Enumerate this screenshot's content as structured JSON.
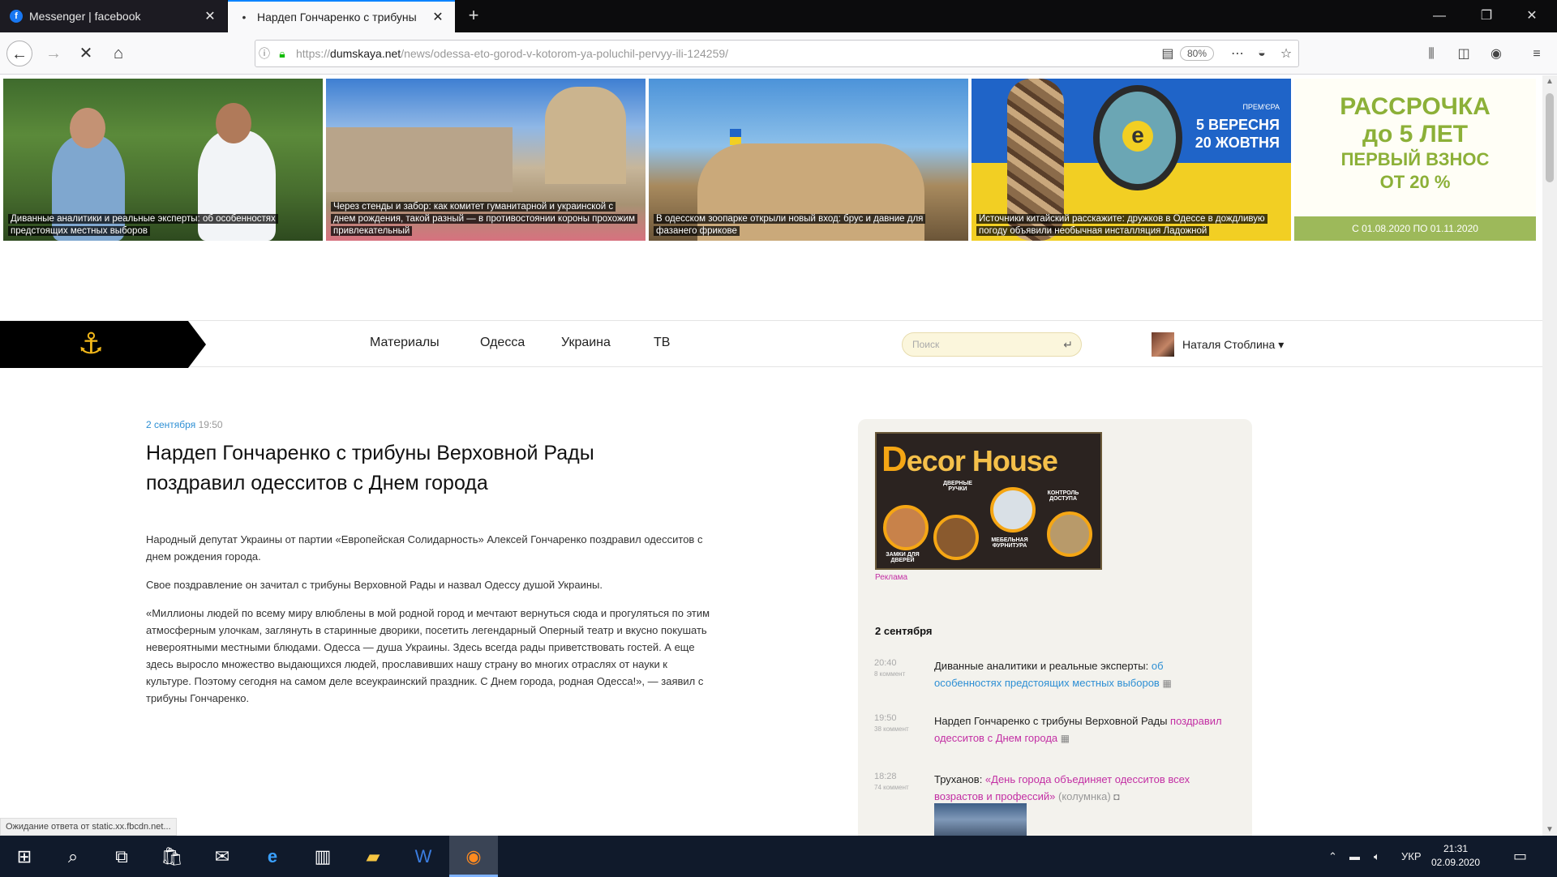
{
  "browser": {
    "tabs": [
      {
        "title": "Messenger | facebook",
        "favicon": "facebook-icon"
      },
      {
        "title": "Нардеп Гончаренко с трибуны",
        "favicon": "loading-dot-icon"
      }
    ],
    "url_prefix": "https://",
    "url_domain": "dumskaya.net",
    "url_path": "/news/odessa-eto-gorod-v-kotorom-ya-poluchil-pervyy-ili-124259/",
    "zoom": "80%",
    "status": "Ожидание ответа от static.xx.fbcdn.net..."
  },
  "news_strip": [
    {
      "caption": "Диванные аналитики и реальные эксперты: об особенностях предстоящих местных выборов"
    },
    {
      "caption": "Через стенды и забор: как комитет гуманитарной и украинской с днем рождения, такой разный — в противостоянии короны прохожим привлекательный"
    },
    {
      "caption": "В одесском зоопарке открыли новый вход: брус и давние для фазанего фрикове"
    },
    {
      "caption": "Источники китайский расскажите: дружков в Одессе в дождливую погоду объявили необычная инсталляция Ладожной"
    }
  ],
  "festival": {
    "subtitle": "ПРЕМ'ЄРА",
    "line1": "5 ВЕРЕСНЯ",
    "line2": "20 ЖОВТНЯ"
  },
  "promo": {
    "line1": "РАССРОЧКА",
    "line2": "до 5 ЛЕТ",
    "line3": "ПЕРВЫЙ ВЗНОС",
    "line4": "ОТ 20 %",
    "dates": "С 01.08.2020 ПО 01.11.2020",
    "text_color": "#8cb038"
  },
  "nav": {
    "menu": [
      "Материалы",
      "Одесса",
      "Украина",
      "ТВ"
    ],
    "search_placeholder": "Поиск",
    "user_name": "Наталя Стоблина ▾"
  },
  "article": {
    "date": "2 сентября",
    "time": "19:50",
    "title": "Нардеп Гончаренко с трибуны Верховной Рады поздравил одесситов с Днем города",
    "paragraphs": [
      "Народный депутат Украины от партии «Европейская Солидарность» Алексей Гончаренко поздравил одесситов с днем рождения города.",
      "Свое поздравление он зачитал с трибуны Верховной Рады и назвал Одессу душой Украины.",
      "«Миллионы людей по всему миру влюблены в мой родной город и мечтают вернуться сюда и прогуляться по этим атмосферным улочкам, заглянуть в старинные дворики, посетить легендарный Оперный театр и вкусно покушать невероятными местными блюдами. Одесса — душа Украины. Здесь всегда рады приветствовать гостей. А еще здесь выросло множество выдающихся людей, прославивших нашу страну во многих отраслях от науки к культуре. Поэтому сегодня на самом деле всеукраинский праздник. С Днем города, родная Одесса!», — заявил с трибуны Гончаренко."
    ]
  },
  "sidebar": {
    "ad_brand_first": "D",
    "ad_brand_rest": "ecor House",
    "ad_labels": [
      "ДВЕРНЫЕ РУЧКИ",
      "КОНТРОЛЬ ДОСТУПА",
      "ЗАМКИ ДЛЯ ДВЕРЕЙ",
      "МЕБЕЛЬНАЯ ФУРНИТУРА"
    ],
    "ad_label": "Реклама",
    "date_header": "2 сентября",
    "feed": [
      {
        "time": "20:40",
        "count": "8 коммент",
        "text": "Диванные аналитики и реальные эксперты: ",
        "link": "об особенностях предстоящих местных выборов",
        "link_color": "blue",
        "extra": "",
        "icon": "▦"
      },
      {
        "time": "19:50",
        "count": "38 коммент",
        "text": "Нардеп Гончаренко с трибуны Верховной Рады ",
        "link": "поздравил одесситов с Днем города",
        "link_color": "pink",
        "extra": "",
        "icon": "▦"
      },
      {
        "time": "18:28",
        "count": "74 коммент",
        "text": "Труханов: ",
        "link": "«День города объединяет одесситов всех возрастов и профессий»",
        "link_color": "pink",
        "extra": " (колумнка) ",
        "icon": "◘"
      }
    ]
  },
  "taskbar": {
    "lang": "УКР",
    "time": "21:31",
    "date": "02.09.2020"
  }
}
